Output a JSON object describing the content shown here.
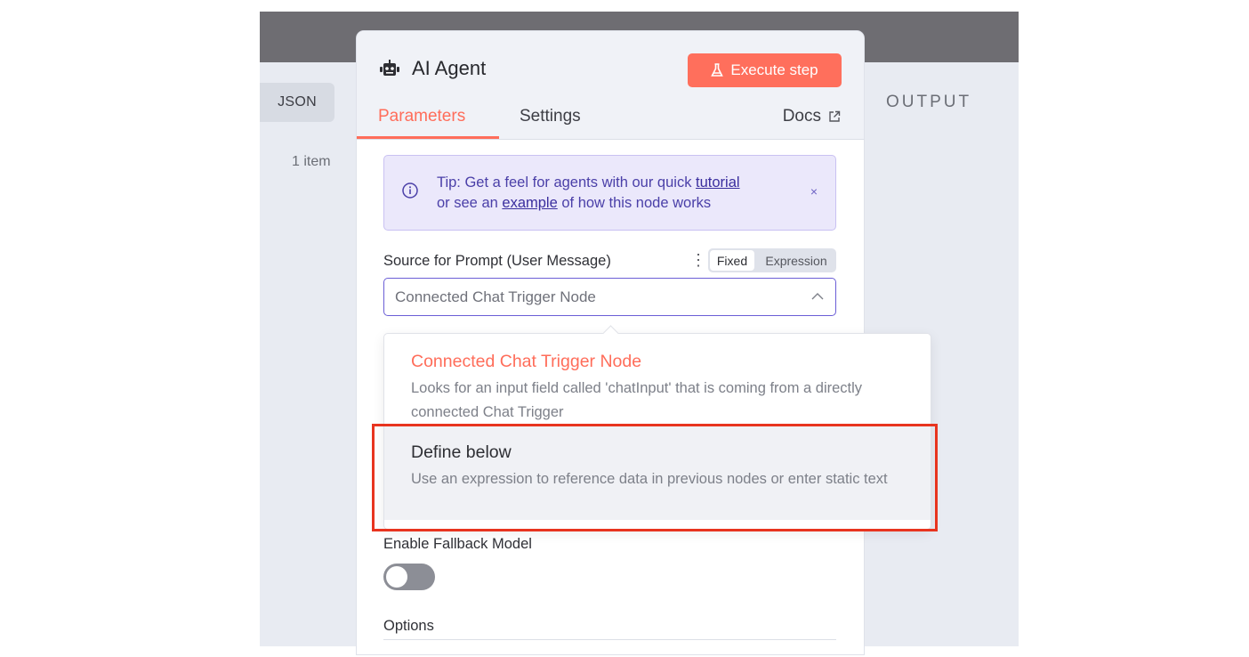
{
  "background": {
    "json_button": "JSON",
    "items_count": "1 item",
    "output_label": "OUTPUT"
  },
  "panel": {
    "title": "AI Agent",
    "execute_button": "Execute step",
    "tabs": [
      "Parameters",
      "Settings"
    ],
    "docs_link": "Docs",
    "tip": {
      "line1_prefix": "Tip: Get a feel for agents with our quick ",
      "tutorial_link": "tutorial",
      "line2_prefix": "or see an ",
      "example_link": "example",
      "line2_suffix": " of how this node works",
      "close": "×"
    },
    "source_label": "Source for Prompt (User Message)",
    "mode_toggle": {
      "fixed": "Fixed",
      "expression": "Expression",
      "selected": "Fixed"
    },
    "source_select": {
      "value": "Connected Chat Trigger Node"
    },
    "fallback_label": "Enable Fallback Model",
    "fallback_enabled": false,
    "options_label": "Options"
  },
  "dropdown": {
    "options": [
      {
        "title": "Connected Chat Trigger Node",
        "description": "Looks for an input field called 'chatInput' that is coming from a directly connected Chat Trigger",
        "selected": true
      },
      {
        "title": "Define below",
        "description": "Use an expression to reference data in previous nodes or enter static text",
        "selected": false,
        "hovered": true
      }
    ]
  },
  "colors": {
    "accent": "#ff6d5a",
    "tip_bg": "#ebe8fb",
    "highlight_box": "#e8341f",
    "select_border": "#6b5ed6"
  },
  "icons": [
    "robot-icon",
    "flask-icon",
    "external-link-icon",
    "info-icon",
    "close-icon",
    "kebab-icon",
    "chevron-up-icon"
  ]
}
